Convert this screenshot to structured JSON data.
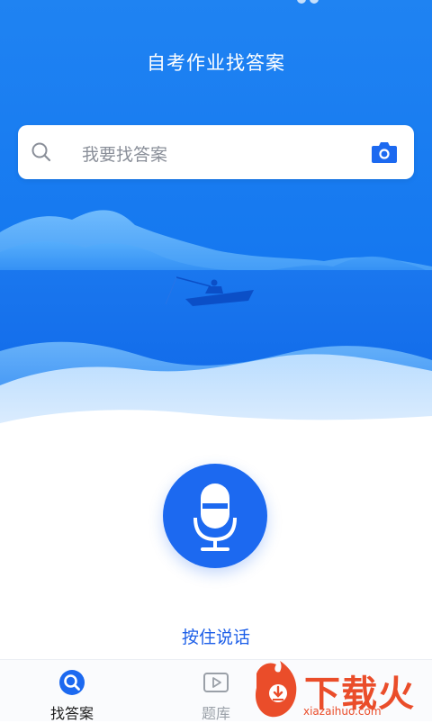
{
  "app": {
    "title": "自考作业找答案"
  },
  "search": {
    "placeholder": "我要找答案"
  },
  "icons": {
    "search": "search-icon",
    "camera": "camera-icon",
    "mic": "microphone-icon",
    "tab_find": "search-circle-icon",
    "tab_bank": "video-play-icon"
  },
  "voice": {
    "hint": "按住说话"
  },
  "tabs": [
    {
      "label": "找答案",
      "active": true
    },
    {
      "label": "题库",
      "active": false
    }
  ],
  "watermark": {
    "brand": "下载火",
    "domain": "xiazaihuo.com"
  },
  "colors": {
    "primary": "#1c69f0",
    "sky_top": "#1e7df0",
    "sky_bottom": "#0c62e8",
    "watermark": "#ea4d2a"
  }
}
